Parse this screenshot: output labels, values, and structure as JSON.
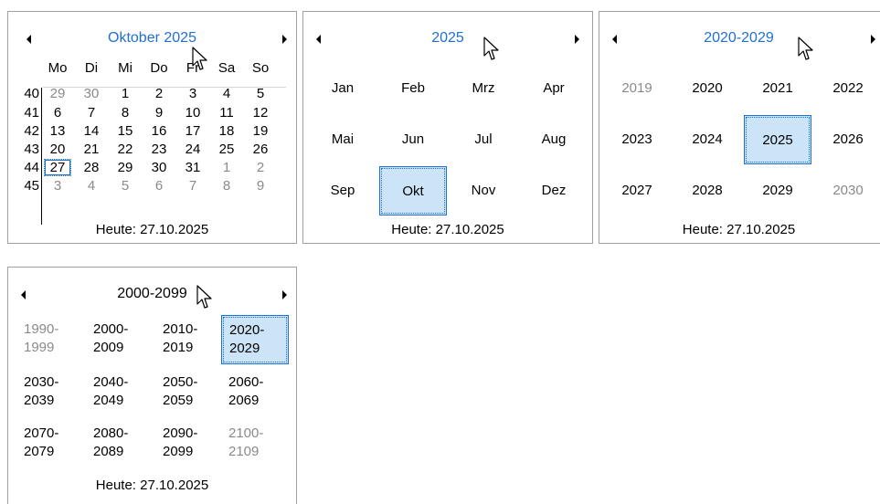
{
  "month_view": {
    "title": "Oktober 2025",
    "weekdays": [
      "Mo",
      "Di",
      "Mi",
      "Do",
      "Fr",
      "Sa",
      "So"
    ],
    "weeks": [
      {
        "num": "40",
        "days": [
          "29",
          "30",
          "1",
          "2",
          "3",
          "4",
          "5"
        ]
      },
      {
        "num": "41",
        "days": [
          "6",
          "7",
          "8",
          "9",
          "10",
          "11",
          "12"
        ]
      },
      {
        "num": "42",
        "days": [
          "13",
          "14",
          "15",
          "16",
          "17",
          "18",
          "19"
        ]
      },
      {
        "num": "43",
        "days": [
          "20",
          "21",
          "22",
          "23",
          "24",
          "25",
          "26"
        ]
      },
      {
        "num": "44",
        "days": [
          "27",
          "28",
          "29",
          "30",
          "31",
          "1",
          "2"
        ]
      },
      {
        "num": "45",
        "days": [
          "3",
          "4",
          "5",
          "6",
          "7",
          "8",
          "9"
        ]
      }
    ],
    "today": "Heute: 27.10.2025"
  },
  "year_view": {
    "title": "2025",
    "months": [
      "Jan",
      "Feb",
      "Mrz",
      "Apr",
      "Mai",
      "Jun",
      "Jul",
      "Aug",
      "Sep",
      "Okt",
      "Nov",
      "Dez"
    ],
    "selected": "Okt",
    "today": "Heute: 27.10.2025"
  },
  "decade_view": {
    "title": "2020-2029",
    "years": [
      "2019",
      "2020",
      "2021",
      "2022",
      "2023",
      "2024",
      "2025",
      "2026",
      "2027",
      "2028",
      "2029",
      "2030"
    ],
    "selected": "2025",
    "today": "Heute: 27.10.2025"
  },
  "century_view": {
    "title": "2000-2099",
    "decades": [
      [
        "1990-",
        "1999"
      ],
      [
        "2000-",
        "2009"
      ],
      [
        "2010-",
        "2019"
      ],
      [
        "2020-",
        "2029"
      ],
      [
        "2030-",
        "2039"
      ],
      [
        "2040-",
        "2049"
      ],
      [
        "2050-",
        "2059"
      ],
      [
        "2060-",
        "2069"
      ],
      [
        "2070-",
        "2079"
      ],
      [
        "2080-",
        "2089"
      ],
      [
        "2090-",
        "2099"
      ],
      [
        "2100-",
        "2109"
      ]
    ],
    "selected": "2020-",
    "today": "Heute: 27.10.2025"
  },
  "colors": {
    "accent": "#1e6fd6",
    "selected_bg": "#cce4f7",
    "muted": "#8a8a8a",
    "border": "#a0a0a0"
  },
  "icons": {
    "prev": "triangle-left-icon",
    "next": "triangle-right-icon",
    "cursor": "mouse-pointer-icon"
  }
}
